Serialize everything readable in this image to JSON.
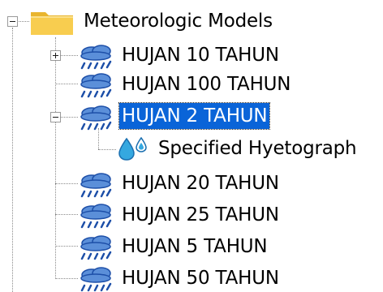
{
  "tree": {
    "root": {
      "label": "Meteorologic Models",
      "icon": "folder-icon",
      "expanded": true
    },
    "models": [
      {
        "label": "HUJAN 10 TAHUN",
        "icon": "meteorologic-model-icon",
        "toggle": "plus"
      },
      {
        "label": "HUJAN 100 TAHUN",
        "icon": "meteorologic-model-icon",
        "toggle": "none"
      },
      {
        "label": "HUJAN 2 TAHUN",
        "icon": "meteorologic-model-icon",
        "toggle": "minus",
        "selected": true,
        "children": [
          {
            "label": "Specified Hyetograph",
            "icon": "precipitation-drops-icon"
          }
        ]
      },
      {
        "label": "HUJAN 20 TAHUN",
        "icon": "meteorologic-model-icon",
        "toggle": "none"
      },
      {
        "label": "HUJAN 25 TAHUN",
        "icon": "meteorologic-model-icon",
        "toggle": "none"
      },
      {
        "label": "HUJAN 5 TAHUN",
        "icon": "meteorologic-model-icon",
        "toggle": "none"
      },
      {
        "label": "HUJAN 50 TAHUN",
        "icon": "meteorologic-model-icon",
        "toggle": "none"
      }
    ]
  },
  "colors": {
    "selection": "#0a64d8",
    "folder": "#f5c842",
    "cloud": "#2b63c9",
    "drops": "#35a8e0"
  }
}
